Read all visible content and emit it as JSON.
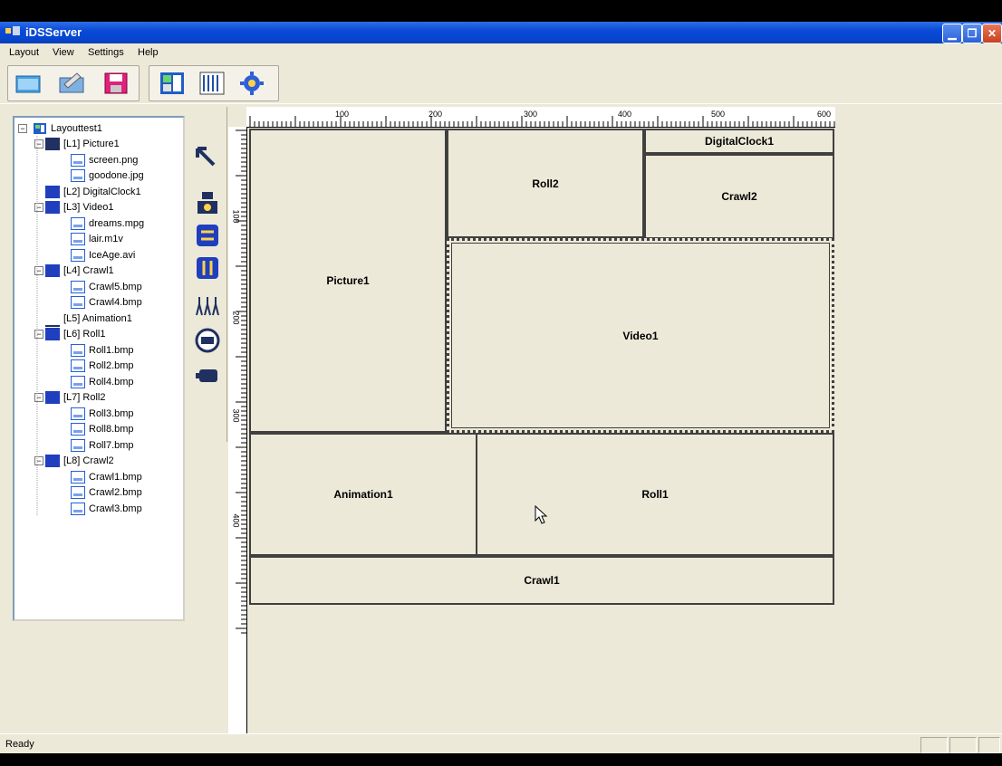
{
  "window": {
    "title": "iDSServer"
  },
  "menu": [
    "Layout",
    "View",
    "Settings",
    "Help"
  ],
  "toolbar": {
    "buttons": [
      "open-layout",
      "edit",
      "save",
      "layout-view",
      "schedule-view",
      "settings"
    ]
  },
  "tree": {
    "root": "Layouttest1",
    "items": [
      {
        "label": "[L1] Picture1",
        "icon": "picture-icon",
        "level": 1
      },
      {
        "label": "screen.png",
        "icon": "file-icon",
        "level": 2
      },
      {
        "label": "goodone.jpg",
        "icon": "file-icon",
        "level": 2
      },
      {
        "label": "[L2] DigitalClock1",
        "icon": "clock-icon",
        "level": 1
      },
      {
        "label": "[L3] Video1",
        "icon": "video-icon",
        "level": 1
      },
      {
        "label": "dreams.mpg",
        "icon": "file-icon",
        "level": 2
      },
      {
        "label": "lair.m1v",
        "icon": "file-icon",
        "level": 2
      },
      {
        "label": "IceAge.avi",
        "icon": "file-icon",
        "level": 2
      },
      {
        "label": "[L4] Crawl1",
        "icon": "crawl-icon",
        "level": 1
      },
      {
        "label": "Crawl5.bmp",
        "icon": "file-icon",
        "level": 2
      },
      {
        "label": "Crawl4.bmp",
        "icon": "file-icon",
        "level": 2
      },
      {
        "label": "[L5] Animation1",
        "icon": "animation-icon",
        "level": 1
      },
      {
        "label": "[L6] Roll1",
        "icon": "roll-icon",
        "level": 1
      },
      {
        "label": "Roll1.bmp",
        "icon": "file-icon",
        "level": 2
      },
      {
        "label": "Roll2.bmp",
        "icon": "file-icon",
        "level": 2
      },
      {
        "label": "Roll4.bmp",
        "icon": "file-icon",
        "level": 2
      },
      {
        "label": "[L7] Roll2",
        "icon": "roll-icon",
        "level": 1
      },
      {
        "label": "Roll3.bmp",
        "icon": "file-icon",
        "level": 2
      },
      {
        "label": "Roll8.bmp",
        "icon": "file-icon",
        "level": 2
      },
      {
        "label": "Roll7.bmp",
        "icon": "file-icon",
        "level": 2
      },
      {
        "label": "[L8] Crawl2",
        "icon": "crawl-icon",
        "level": 1
      },
      {
        "label": "Crawl1.bmp",
        "icon": "file-icon",
        "level": 2
      },
      {
        "label": "Crawl2.bmp",
        "icon": "file-icon",
        "level": 2
      },
      {
        "label": "Crawl3.bmp",
        "icon": "file-icon",
        "level": 2
      }
    ]
  },
  "tools": [
    "pointer-tool-icon",
    "picture-tool-icon",
    "crawl-tool-icon",
    "roll-tool-icon",
    "animation-tool-icon",
    "clock-tool-icon",
    "video-tool-icon"
  ],
  "ruler": {
    "horizontal": [
      "100",
      "200",
      "300",
      "400",
      "500",
      "600"
    ],
    "vertical": [
      "100",
      "200",
      "300",
      "400"
    ]
  },
  "regions": {
    "picture1": "Picture1",
    "roll2": "Roll2",
    "digitalclock1": "DigitalClock1",
    "crawl2": "Crawl2",
    "video1": "Video1",
    "animation1": "Animation1",
    "roll1": "Roll1",
    "crawl1": "Crawl1"
  },
  "status": {
    "text": "Ready"
  }
}
